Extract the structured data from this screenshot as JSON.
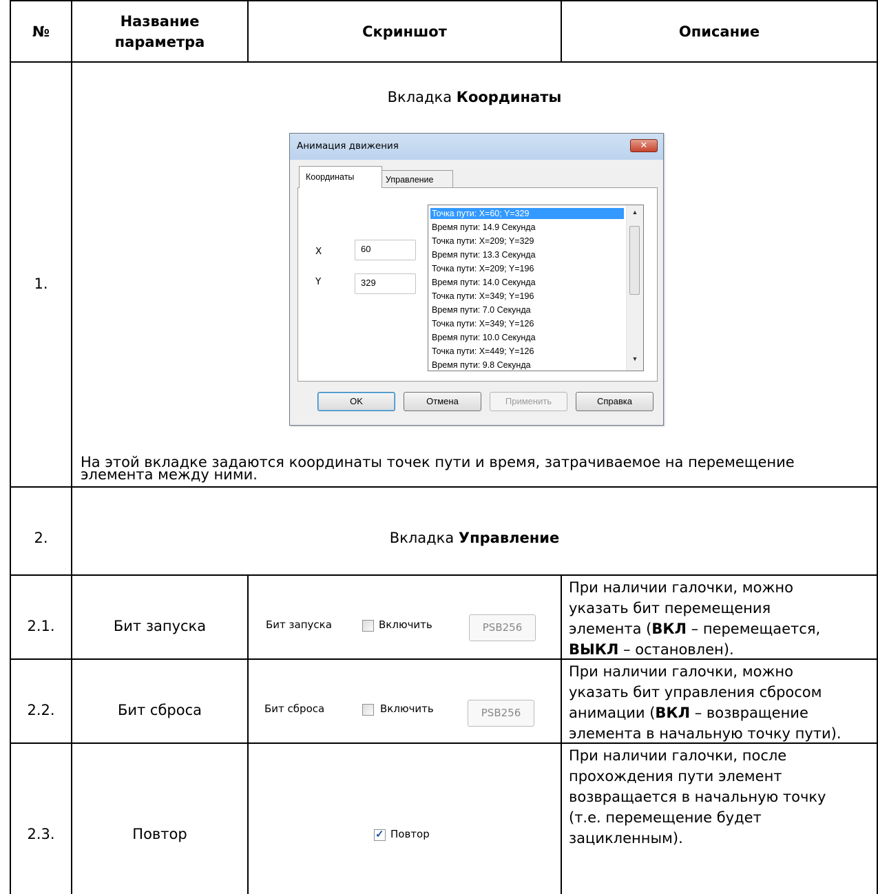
{
  "table": {
    "headers": {
      "num": "№",
      "name_line1": "Название",
      "name_line2": "параметра",
      "screenshot": "Скриншот",
      "description": "Описание"
    },
    "row1": {
      "num": "1.",
      "heading_prefix": "Вкладка ",
      "heading_bold": "Координаты",
      "text_line1": "На этой вкладке задаются координаты точек пути и время, затрачиваемое на перемещение",
      "text_line2": "элемента между ними."
    },
    "row2": {
      "num": "2.",
      "heading_prefix": "Вкладка ",
      "heading_bold": "Управление"
    },
    "row21": {
      "num": "2.1.",
      "name": "Бит запуска",
      "desc": [
        "При наличии галочки, можно",
        "указать бит перемещения",
        {
          "pre": "элемента (",
          "bold": "ВКЛ",
          "post": " – перемещается,"
        },
        {
          "pre": "",
          "bold": "ВЫКЛ",
          "post": " – остановлен)."
        }
      ]
    },
    "row22": {
      "num": "2.2.",
      "name": "Бит сброса",
      "desc": [
        "При наличии галочки, можно",
        "указать бит управления сбросом",
        {
          "pre": "анимации (",
          "bold": "ВКЛ",
          "post": " – возвращение"
        },
        "элемента в начальную точку пути)."
      ]
    },
    "row23": {
      "num": "2.3.",
      "name": "Повтор",
      "desc": [
        "При наличии галочки, после",
        "прохождения пути элемент",
        "возвращается в начальную точку",
        "(т.е. перемещение будет",
        "зацикленным)."
      ]
    }
  },
  "dialog": {
    "title": "Анимация движения",
    "close_glyph": "✕",
    "tabs": [
      "Координаты",
      "Управление"
    ],
    "x_label": "X",
    "x_value": "60",
    "y_label": "Y",
    "y_value": "329",
    "list_items": [
      "Точка пути: X=60; Y=329",
      "Время пути: 14.9 Секунда",
      "Точка пути: X=209; Y=329",
      "Время пути: 13.3 Секунда",
      "Точка пути: X=209; Y=196",
      "Время пути: 14.0 Секунда",
      "Точка пути: X=349; Y=196",
      "Время пути: 7.0 Секунда",
      "Точка пути: X=349; Y=126",
      "Время пути: 10.0 Секунда",
      "Точка пути: X=449; Y=126",
      "Время пути: 9.8 Секунда"
    ],
    "selected_index": 0,
    "buttons": {
      "ok": "OK",
      "cancel": "Отмена",
      "apply": "Применить",
      "help": "Справка"
    }
  },
  "controls": {
    "start_bit_label": "Бит запуска",
    "reset_bit_label": "Бит сброса",
    "enable_label": "Включить",
    "psb_value": "PSB256",
    "repeat_label": "Повтор",
    "repeat_checked": true,
    "check_glyph": "✓"
  }
}
